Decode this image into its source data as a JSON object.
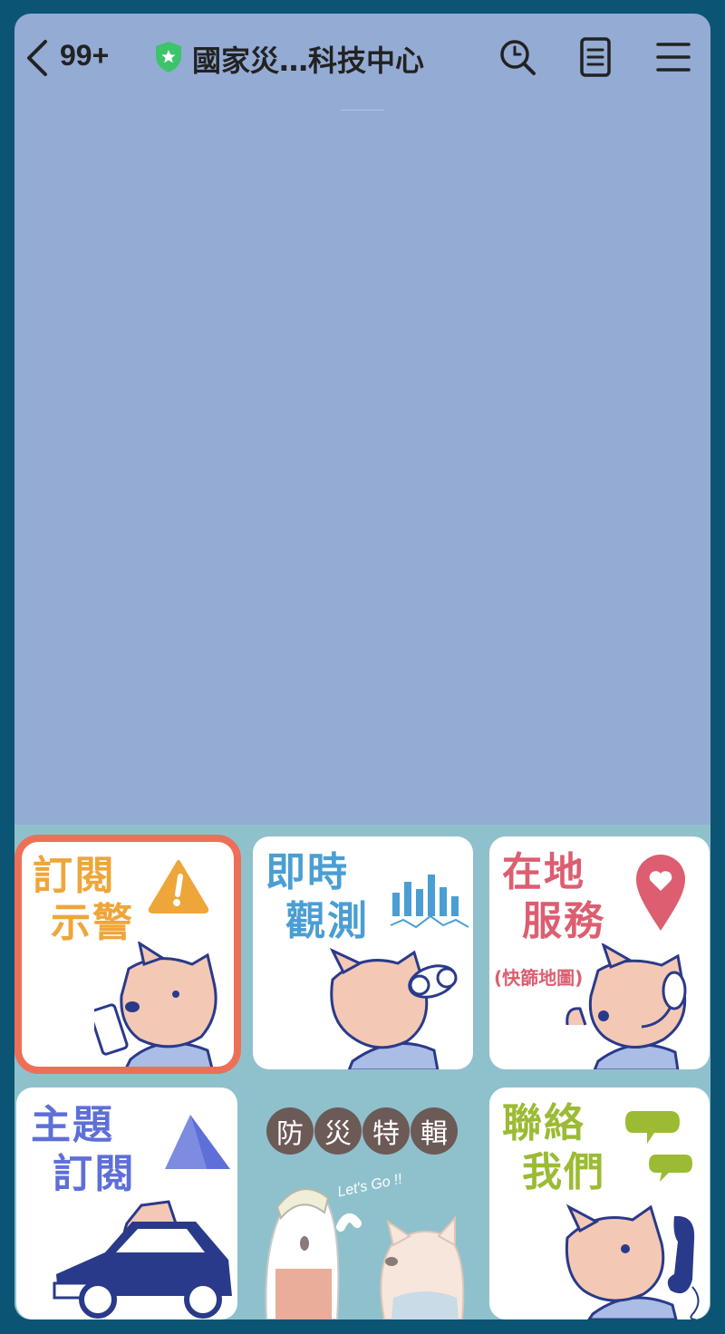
{
  "header": {
    "back_count": "99+",
    "title": "國家災…科技中心"
  },
  "menu": {
    "tiles": [
      {
        "label_line1": "訂閱",
        "label_line2": "示警",
        "color": "#eea63a"
      },
      {
        "label_line1": "即時",
        "label_line2": "觀測",
        "color": "#4a9ed4"
      },
      {
        "label_line1": "在地",
        "label_line2": "服務",
        "sub": "(快篩地圖)",
        "color": "#dc5e70"
      },
      {
        "label_line1": "主題",
        "label_line2": "訂閱",
        "color": "#5e6fd8"
      },
      {
        "chars": [
          "防",
          "災",
          "特",
          "輯"
        ],
        "tagline": "Let's Go !!"
      },
      {
        "label_line1": "聯絡",
        "label_line2": "我們",
        "color": "#9bbb34"
      }
    ]
  }
}
